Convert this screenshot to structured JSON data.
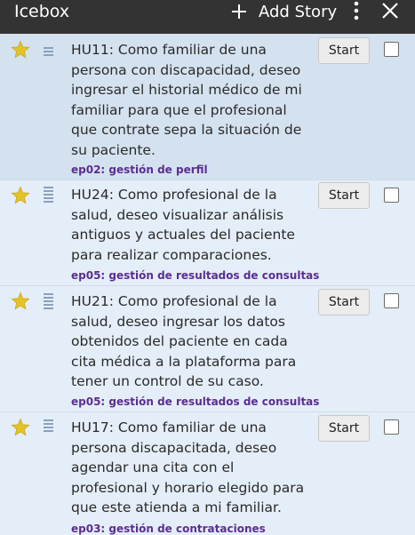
{
  "header": {
    "title": "Icebox",
    "add_story_label": "Add Story"
  },
  "stories": [
    {
      "text": "HU11: Como familiar de una persona con discapacidad, deseo ingresar el historial médico de mi familiar para que el profesional que contrate sepa la situación de su paciente.",
      "epic": "ep02: gestión de perfil",
      "start_label": "Start"
    },
    {
      "text": "HU24: Como profesional de la salud, deseo visualizar análisis antiguos y actuales del paciente para realizar comparaciones.",
      "epic": "ep05: gestión de resultados de consultas",
      "start_label": "Start"
    },
    {
      "text": "HU21: Como profesional de la salud, deseo ingresar los datos obtenidos del paciente en cada cita médica a la plataforma para tener un control de su caso.",
      "epic": "ep05: gestión de resultados de consultas",
      "start_label": "Start"
    },
    {
      "text": "HU17: Como familiar de una persona discapacitada, deseo agendar una cita con el profesional y horario elegido para que este atienda a mi familiar.",
      "epic": "ep03: gestión de contrataciones",
      "start_label": "Start"
    }
  ]
}
